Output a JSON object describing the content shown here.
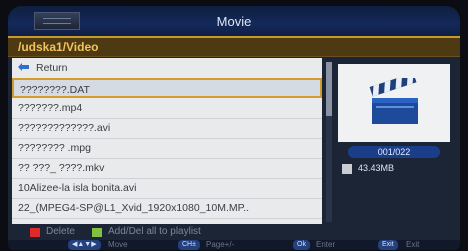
{
  "window": {
    "title": "Movie"
  },
  "path": "/udska1/Video",
  "files": [
    {
      "label": "Return",
      "type": "return"
    },
    {
      "label": "????????.DAT",
      "selected": true
    },
    {
      "label": "???????.mp4"
    },
    {
      "label": "?????????????.avi"
    },
    {
      "label": "???????? .mpg"
    },
    {
      "label": "?? ???_ ????.mkv"
    },
    {
      "label": "10Alizee-la isla bonita.avi"
    },
    {
      "label": "22_(MPEG4-SP@L1_Xvid_1920x1080_10M.MP.."
    }
  ],
  "preview": {
    "icon": "clapperboard-icon",
    "counter": "001/022",
    "size": "43.43MB"
  },
  "hints": {
    "delete": "Delete",
    "add": "Add/Del all to playlist"
  },
  "footer": [
    {
      "key": "◀▲▼▶",
      "label": "Move"
    },
    {
      "key": "CH±",
      "label": "Page+/-"
    },
    {
      "key": "Ok",
      "label": "Enter"
    },
    {
      "key": "Exit",
      "label": "Exit"
    }
  ],
  "colors": {
    "selection_border": "#d39a2c",
    "path_text": "#f2c35a",
    "counter_bg": "#1a3e8a",
    "delete_red": "#e02a2a",
    "add_green": "#7fc241"
  }
}
